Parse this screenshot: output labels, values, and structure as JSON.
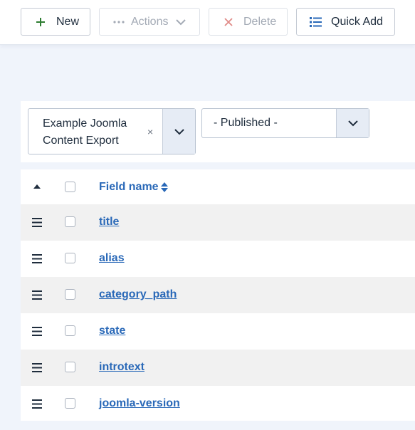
{
  "toolbar": {
    "new_label": "New",
    "actions_label": "Actions",
    "delete_label": "Delete",
    "quickadd_label": "Quick Add"
  },
  "filters": {
    "export_select": {
      "value": "Example Joomla Content Export",
      "clear": "×"
    },
    "published_select": {
      "value": "- Published -"
    }
  },
  "table": {
    "header": {
      "field_name": "Field name"
    },
    "rows": [
      {
        "name": "title"
      },
      {
        "name": "alias"
      },
      {
        "name": "category_path"
      },
      {
        "name": "state"
      },
      {
        "name": "introtext"
      },
      {
        "name": "joomla-version"
      }
    ]
  },
  "colors": {
    "link": "#2a69b8",
    "delete_icon": "#d9534f",
    "new_icon": "#2e7d32",
    "quickadd_icon": "#2a69b8"
  },
  "icons": [
    "plus-icon",
    "ellipsis-icon",
    "chevron-down-icon",
    "close-icon",
    "list-icon",
    "caret-up-icon",
    "sort-icon",
    "drag-handle-icon"
  ]
}
